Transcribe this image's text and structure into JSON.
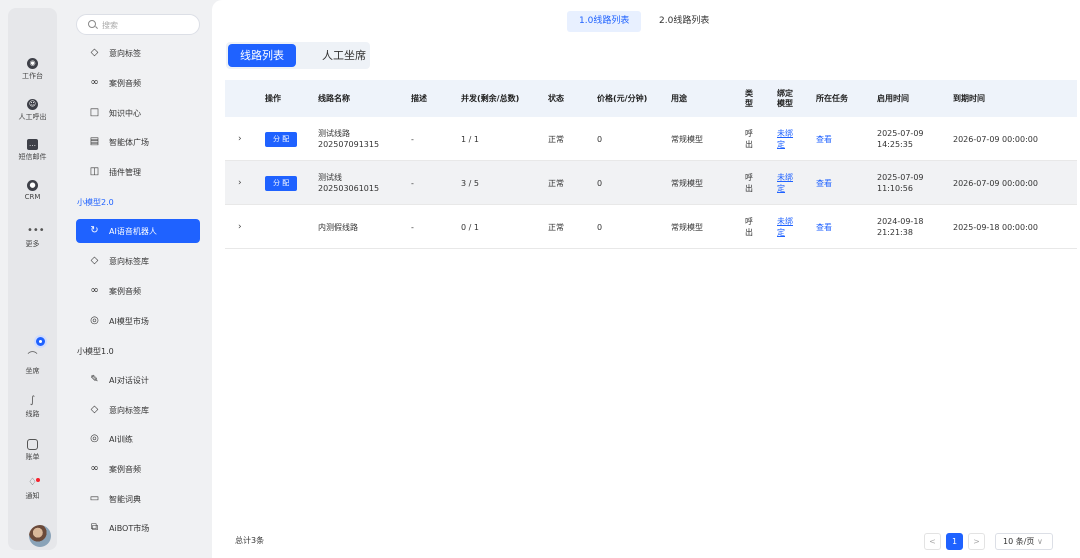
{
  "rail": {
    "items": [
      {
        "label": "工作台",
        "icon": "workbench-icon"
      },
      {
        "label": "人工呼出",
        "icon": "manual-call-icon"
      },
      {
        "label": "短信邮件",
        "icon": "message-icon"
      },
      {
        "label": "CRM",
        "icon": "crm-icon"
      },
      {
        "label": "更多",
        "icon": "more-icon",
        "glyph": "•••"
      },
      {
        "label": "坐席",
        "icon": "headset-icon"
      },
      {
        "label": "线路",
        "icon": "route-icon"
      },
      {
        "label": "账单",
        "icon": "bill-icon"
      },
      {
        "label": "通知",
        "icon": "bell-icon"
      }
    ]
  },
  "menu": {
    "search_placeholder": "搜索",
    "top_items": [
      {
        "label": "意向标签",
        "icon": "tag-icon"
      },
      {
        "label": "案例音频",
        "icon": "audio-icon"
      },
      {
        "label": "知识中心",
        "icon": "book-icon"
      },
      {
        "label": "智能体广场",
        "icon": "store-icon"
      },
      {
        "label": "插件管理",
        "icon": "plugin-icon"
      }
    ],
    "section_v2": "小模型2.0",
    "v2_items": [
      {
        "label": "AI语音机器人",
        "icon": "robot-icon",
        "active": true
      },
      {
        "label": "意向标签库",
        "icon": "tag-icon"
      },
      {
        "label": "案例音频",
        "icon": "audio-icon"
      },
      {
        "label": "AI模型市场",
        "icon": "market-icon"
      }
    ],
    "section_v1": "小模型1.0",
    "v1_items": [
      {
        "label": "AI对话设计",
        "icon": "pen-icon"
      },
      {
        "label": "意向标签库",
        "icon": "tag-icon"
      },
      {
        "label": "AI训练",
        "icon": "training-icon"
      },
      {
        "label": "案例音频",
        "icon": "audio-icon"
      },
      {
        "label": "智能词典",
        "icon": "dictionary-icon"
      },
      {
        "label": "AiBOT市场",
        "icon": "bot-market-icon"
      }
    ]
  },
  "version_tabs": [
    "1.0线路列表",
    "2.0线路列表"
  ],
  "tabs": [
    "线路列表",
    "人工坐席"
  ],
  "table": {
    "headers": {
      "op": "操作",
      "name": "线路名称",
      "desc": "描述",
      "concurrency": "并发(剩余/总数)",
      "status": "状态",
      "price": "价格(元/分钟)",
      "usage": "用途",
      "type": "类型",
      "model": "绑定模型",
      "task": "所在任务",
      "start": "启用时间",
      "end": "到期时间"
    },
    "rows": [
      {
        "op": "分 配",
        "name": "测试线路 202507091315",
        "desc": "-",
        "concurrency": "1 / 1",
        "status": "正常",
        "price": "0",
        "usage": "常规模型",
        "type": "呼出",
        "model": "未绑定",
        "task": "查看",
        "start": "2025-07-09 14:25:35",
        "end": "2026-07-09 00:00:00"
      },
      {
        "op": "分 配",
        "name": "测试线 202503061015",
        "desc": "-",
        "concurrency": "3 / 5",
        "status": "正常",
        "price": "0",
        "usage": "常规模型",
        "type": "呼出",
        "model": "未绑定",
        "task": "查看",
        "start": "2025-07-09 11:10:56",
        "end": "2026-07-09 00:00:00"
      },
      {
        "op": "",
        "name": "内测假线路",
        "desc": "-",
        "concurrency": "0 / 1",
        "status": "正常",
        "price": "0",
        "usage": "常规模型",
        "type": "呼出",
        "model": "未绑定",
        "task": "查看",
        "start": "2024-09-18 21:21:38",
        "end": "2025-09-18 00:00:00"
      }
    ]
  },
  "footer": {
    "total": "总计3条",
    "prev": "<",
    "page": "1",
    "next": ">",
    "page_size": "10 条/页"
  }
}
